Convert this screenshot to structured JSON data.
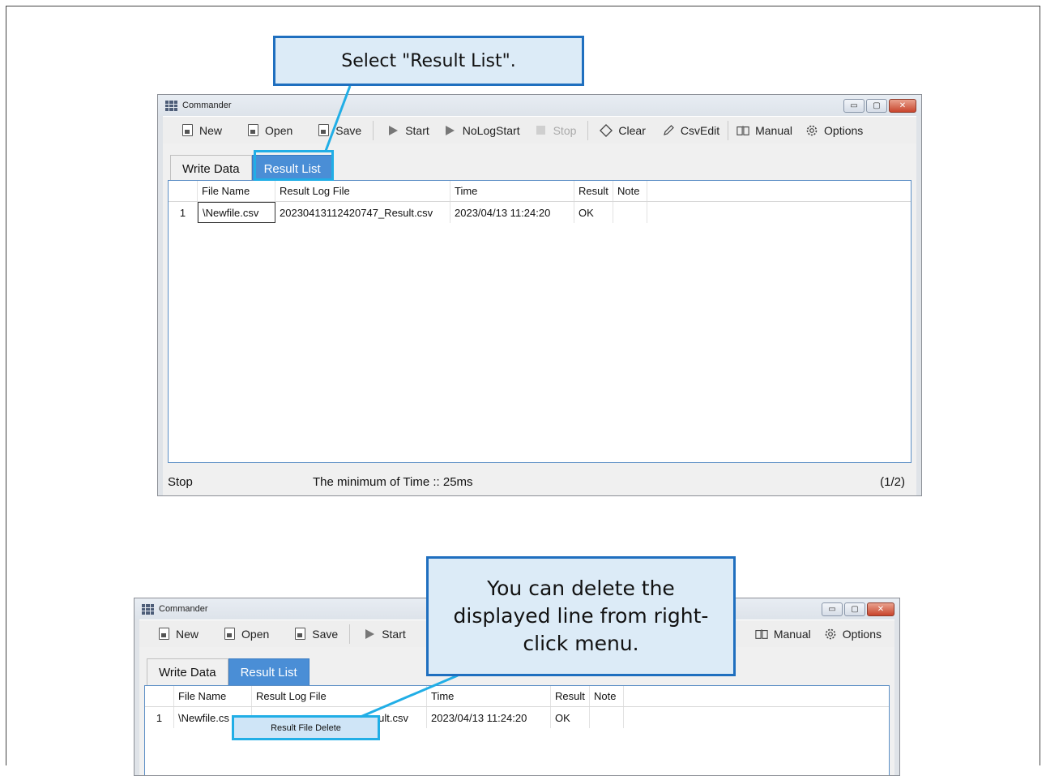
{
  "window": {
    "title": "Commander",
    "controls": {
      "minimize": "▭",
      "maximize": "▢",
      "close": "✕"
    }
  },
  "toolbar": {
    "new": "New",
    "open": "Open",
    "save": "Save",
    "start": "Start",
    "nologstart": "NoLogStart",
    "stop": "Stop",
    "clear": "Clear",
    "csvedit": "CsvEdit",
    "manual": "Manual",
    "options": "Options"
  },
  "tabs": {
    "write_data": "Write Data",
    "result_list": "Result List"
  },
  "table": {
    "columns": {
      "file_name": "File Name",
      "result_log_file": "Result Log File",
      "time": "Time",
      "result": "Result",
      "note": "Note"
    },
    "rows": [
      {
        "index": "1",
        "file_name": "\\Newfile.csv",
        "result_log_file": "20230413112420747_Result.csv",
        "time": "2023/04/13 11:24:20",
        "result": "OK",
        "note": ""
      }
    ]
  },
  "lower_row": {
    "file_name": "\\Newfile.cs",
    "result_log_file": "sult.csv"
  },
  "status": {
    "state": "Stop",
    "message": "The minimum of Time :: 25ms",
    "page": "(1/2)"
  },
  "context_menu": {
    "item": "Result File Delete"
  },
  "callouts": {
    "top": "Select \"Result List\".",
    "bottom_line1": "You can delete the",
    "bottom_line2": "displayed line from right-",
    "bottom_line3": "click menu."
  },
  "colors": {
    "accent": "#4a8ed6",
    "callout_border": "#1f6fbf",
    "callout_fill": "#dcebf7",
    "highlight": "#21aee6"
  },
  "icons": {
    "new": "document-icon",
    "open": "document-icon",
    "save": "document-icon",
    "start": "play-icon",
    "stop": "stop-icon",
    "clear": "eraser-icon",
    "csvedit": "pencil-icon",
    "manual": "book-icon",
    "options": "gear-icon"
  }
}
